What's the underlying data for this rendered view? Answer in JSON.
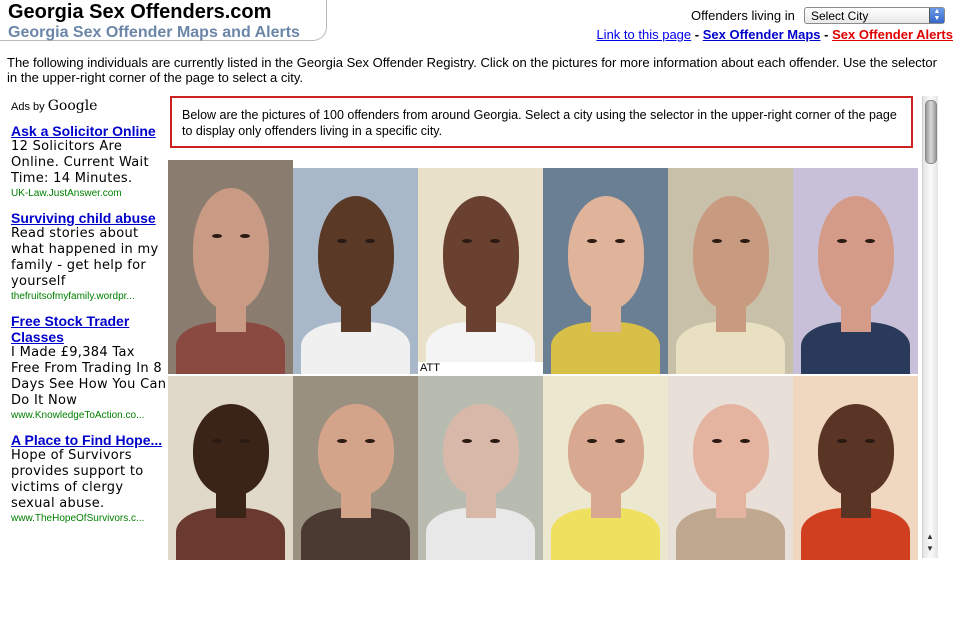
{
  "header": {
    "site_title": "Georgia Sex Offenders.com",
    "site_subtitle": "Georgia Sex Offender Maps and Alerts"
  },
  "city_selector": {
    "label": "Offenders living in",
    "selected": "Select City"
  },
  "top_links": {
    "link_page": "Link to this page",
    "maps": "Sex Offender Maps",
    "alerts": "Sex Offender Alerts",
    "separator": "-"
  },
  "intro": "The following individuals are currently listed in the Georgia Sex Offender Registry. Click on the pictures for more information about each offender. Use the selector in the upper-right corner of the page to select a city.",
  "ads": {
    "label": "Ads by",
    "brand": "Google",
    "items": [
      {
        "title": "Ask a Solicitor Online",
        "body": "12 Solicitors Are Online. Current Wait Time: 14 Minutes.",
        "url": "UK-Law.JustAnswer.com"
      },
      {
        "title": "Surviving child abuse",
        "body": "Read stories about what happened in my family - get help for yourself",
        "url": "thefruitsofmyfamily.wordpr..."
      },
      {
        "title": "Free Stock Trader Classes",
        "body": "I Made £9,384 Tax Free From Trading In 8 Days See How You Can Do It Now",
        "url": "www.KnowledgeToAction.co..."
      },
      {
        "title": "A Place to Find Hope...",
        "body": "Hope of Survivors provides support to victims of clergy sexual abuse.",
        "url": "www.TheHopeOfSurvivors.c..."
      }
    ]
  },
  "notice": "Below are the pictures of 100 offenders from around Georgia. Select a city using the selector in the upper-right corner of the page to display only offenders living in a specific city.",
  "photos": [
    {
      "bg": "#8a7d70",
      "skin": "#c99a84",
      "shirt": "#8a4a42"
    },
    {
      "bg": "#a8b8c8",
      "skin": "#5a3a26",
      "shirt": "#f0f0f0"
    },
    {
      "bg": "#e8e0c8",
      "skin": "#6a4030",
      "shirt": "#f4f4f4",
      "caption": "ATT"
    },
    {
      "bg": "#6a7e94",
      "skin": "#e0b49a",
      "shirt": "#d8c048"
    },
    {
      "bg": "#c8c0a8",
      "skin": "#c89a80",
      "shirt": "#e8e0c0"
    },
    {
      "bg": "#c8c0d8",
      "skin": "#d49c88",
      "shirt": "#2a3a5a"
    },
    {
      "bg": "#e0d8c8",
      "skin": "#3a2418",
      "shirt": "#6a3a30"
    },
    {
      "bg": "#9a9080",
      "skin": "#d4a48a",
      "shirt": "#4a3a32"
    },
    {
      "bg": "#b8bcb0",
      "skin": "#d8b8a8",
      "shirt": "#e8e8e8"
    },
    {
      "bg": "#ece8d0",
      "skin": "#d8a890",
      "shirt": "#f0e060"
    },
    {
      "bg": "#e8e0d8",
      "skin": "#e4b4a0",
      "shirt": "#c0a890"
    },
    {
      "bg": "#f0d8c0",
      "skin": "#5a3424",
      "shirt": "#d04020"
    }
  ]
}
